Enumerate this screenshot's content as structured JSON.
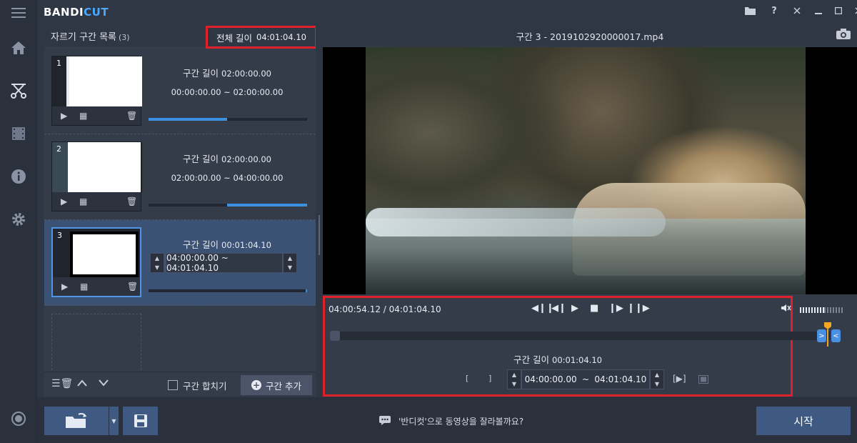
{
  "app": {
    "logo_part1": "BANDI",
    "logo_part2": "CUT",
    "brand_color": "#4aa8ff",
    "highlight_color": "#e0212a"
  },
  "segment_list": {
    "title": "자르기 구간 목록",
    "count": "(3)",
    "total_label": "전체 길이",
    "total_value": "04:01:04.10",
    "segments": [
      {
        "num": "1",
        "len_label": "구간 길이",
        "len_value": "02:00:00.00",
        "range": "00:00:00.00 ~ 02:00:00.00"
      },
      {
        "num": "2",
        "len_label": "구간 길이",
        "len_value": "02:00:00.00",
        "range": "02:00:00.00 ~ 04:00:00.00"
      },
      {
        "num": "3",
        "len_label": "구간 길이",
        "len_value": "00:01:04.10",
        "range": "04:00:00.00 ~ 04:01:04.10"
      }
    ],
    "merge_label": "구간 합치기",
    "add_label": "구간 추가"
  },
  "player": {
    "title": "구간 3 - 2019102920000017.mp4",
    "current_time": "04:00:54.12 / 04:01:04.10",
    "len_label": "구간 길이",
    "len_value": "00:01:04.10",
    "start_time": "04:00:00.00",
    "tilde": "~",
    "end_time": "04:01:04.10",
    "bracket_open": "[",
    "bracket_close": "]",
    "play_range": "[▶]"
  },
  "bottom": {
    "hint": "'반디컷'으로 동영상을 잘라볼까요?",
    "start_label": "시작"
  }
}
